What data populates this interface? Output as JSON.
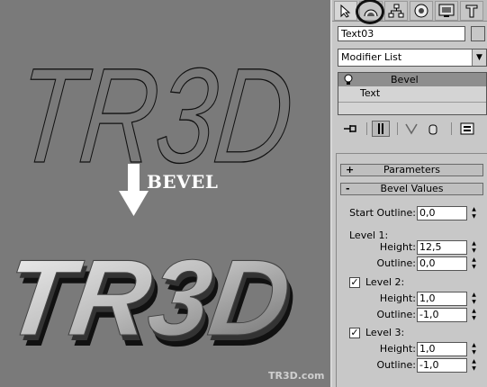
{
  "viewport": {
    "outline_text": "TR3D",
    "bevel_text": "TR3D",
    "operation_label": "BEVEL",
    "watermark": "TR3D.com"
  },
  "panel": {
    "tabs": [
      {
        "icon": "create-arrow-icon"
      },
      {
        "icon": "modify-icon"
      },
      {
        "icon": "hierarchy-icon"
      },
      {
        "icon": "motion-icon"
      },
      {
        "icon": "display-icon"
      },
      {
        "icon": "utilities-icon"
      }
    ],
    "object_name": "Text03",
    "modifier_list": "Modifier List",
    "stack": {
      "items": [
        "Bevel",
        "Text"
      ]
    },
    "rollouts": {
      "parameters": {
        "sign": "+",
        "title": "Parameters"
      },
      "bevel_values": {
        "sign": "-",
        "title": "Bevel Values"
      }
    },
    "fields": {
      "start_outline": {
        "label": "Start Outline:",
        "value": "0,0"
      },
      "level1": {
        "label": "Level 1:"
      },
      "l1_height": {
        "label": "Height:",
        "value": "12,5"
      },
      "l1_outline": {
        "label": "Outline:",
        "value": "0,0"
      },
      "level2": {
        "label": "Level 2:",
        "checked": "✓"
      },
      "l2_height": {
        "label": "Height:",
        "value": "1,0"
      },
      "l2_outline": {
        "label": "Outline:",
        "value": "-1,0"
      },
      "level3": {
        "label": "Level 3:",
        "checked": "✓"
      },
      "l3_height": {
        "label": "Height:",
        "value": "1,0"
      },
      "l3_outline": {
        "label": "Outline:",
        "value": "-1,0"
      }
    }
  }
}
